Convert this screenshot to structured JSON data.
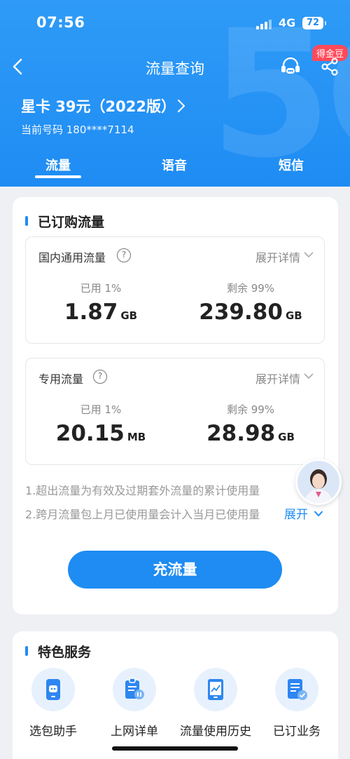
{
  "status_bar": {
    "time": "07:56",
    "network": "4G",
    "battery": "72"
  },
  "nav": {
    "title": "流量查询",
    "reward_badge": "得金豆"
  },
  "plan": {
    "name": "星卡 39元（2022版）",
    "phone_line": "当前号码 180****7114"
  },
  "tabs": [
    {
      "label": "流量",
      "active": true
    },
    {
      "label": "语音",
      "active": false
    },
    {
      "label": "短信",
      "active": false
    }
  ],
  "subscribed": {
    "title": "已订购流量",
    "domestic": {
      "title": "国内通用流量",
      "help": "?",
      "expand": "展开详情",
      "used_label": "已用 1%",
      "used_value": "1.87",
      "used_unit": "GB",
      "remaining_label": "剩余 99%",
      "remaining_value": "239.80",
      "remaining_unit": "GB"
    },
    "dedicated": {
      "title": "专用流量",
      "help": "?",
      "expand": "展开详情",
      "used_label": "已用 1%",
      "used_value": "20.15",
      "used_unit": "MB",
      "remaining_label": "剩余 99%",
      "remaining_value": "28.98",
      "remaining_unit": "GB"
    },
    "notes": [
      "1.超出流量为有效及过期套外流量的累计使用量",
      "2.跨月流量包上月已使用量会计入当月已使用量"
    ],
    "expand_link": "展开",
    "recharge_button": "充流量"
  },
  "services": {
    "title": "特色服务",
    "items": [
      {
        "label": "选包助手",
        "icon": "package-assistant-icon"
      },
      {
        "label": "上网详单",
        "icon": "usage-detail-icon"
      },
      {
        "label": "流量使用历史",
        "icon": "usage-history-icon"
      },
      {
        "label": "已订业务",
        "icon": "subscribed-services-icon"
      }
    ]
  },
  "colors": {
    "primary": "#1e8cf3",
    "badge": "#ff4a5a"
  }
}
